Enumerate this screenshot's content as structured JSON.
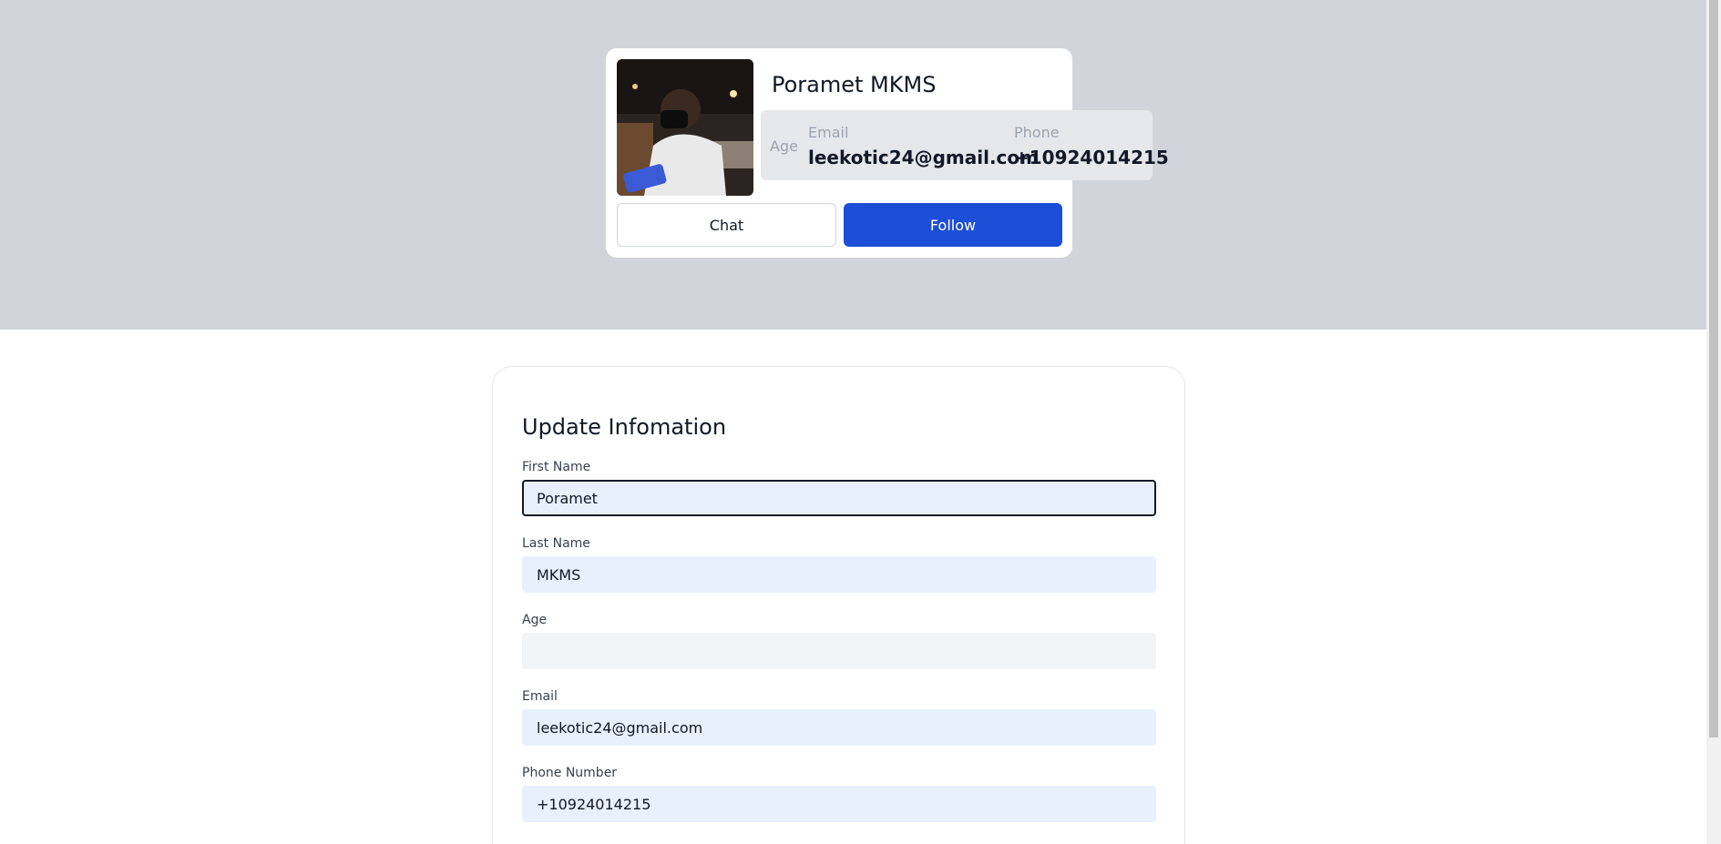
{
  "profile": {
    "name": "Poramet MKMS",
    "stats": {
      "age_label": "Age",
      "email_label": "Email",
      "email_value": "leekotic24@gmail.com",
      "phone_label": "Phone",
      "phone_value": "+10924014215"
    },
    "chat_label": "Chat",
    "follow_label": "Follow"
  },
  "form": {
    "title": "Update Infomation",
    "fields": [
      {
        "label": "First Name",
        "value": "Poramet"
      },
      {
        "label": "Last Name",
        "value": "MKMS"
      },
      {
        "label": "Age",
        "value": ""
      },
      {
        "label": "Email",
        "value": "leekotic24@gmail.com"
      },
      {
        "label": "Phone Number",
        "value": "+10924014215"
      }
    ]
  },
  "colors": {
    "banner": "#d1d5db",
    "follow_button": "#1d4ed8",
    "input_fill": "#e8f0fe"
  }
}
